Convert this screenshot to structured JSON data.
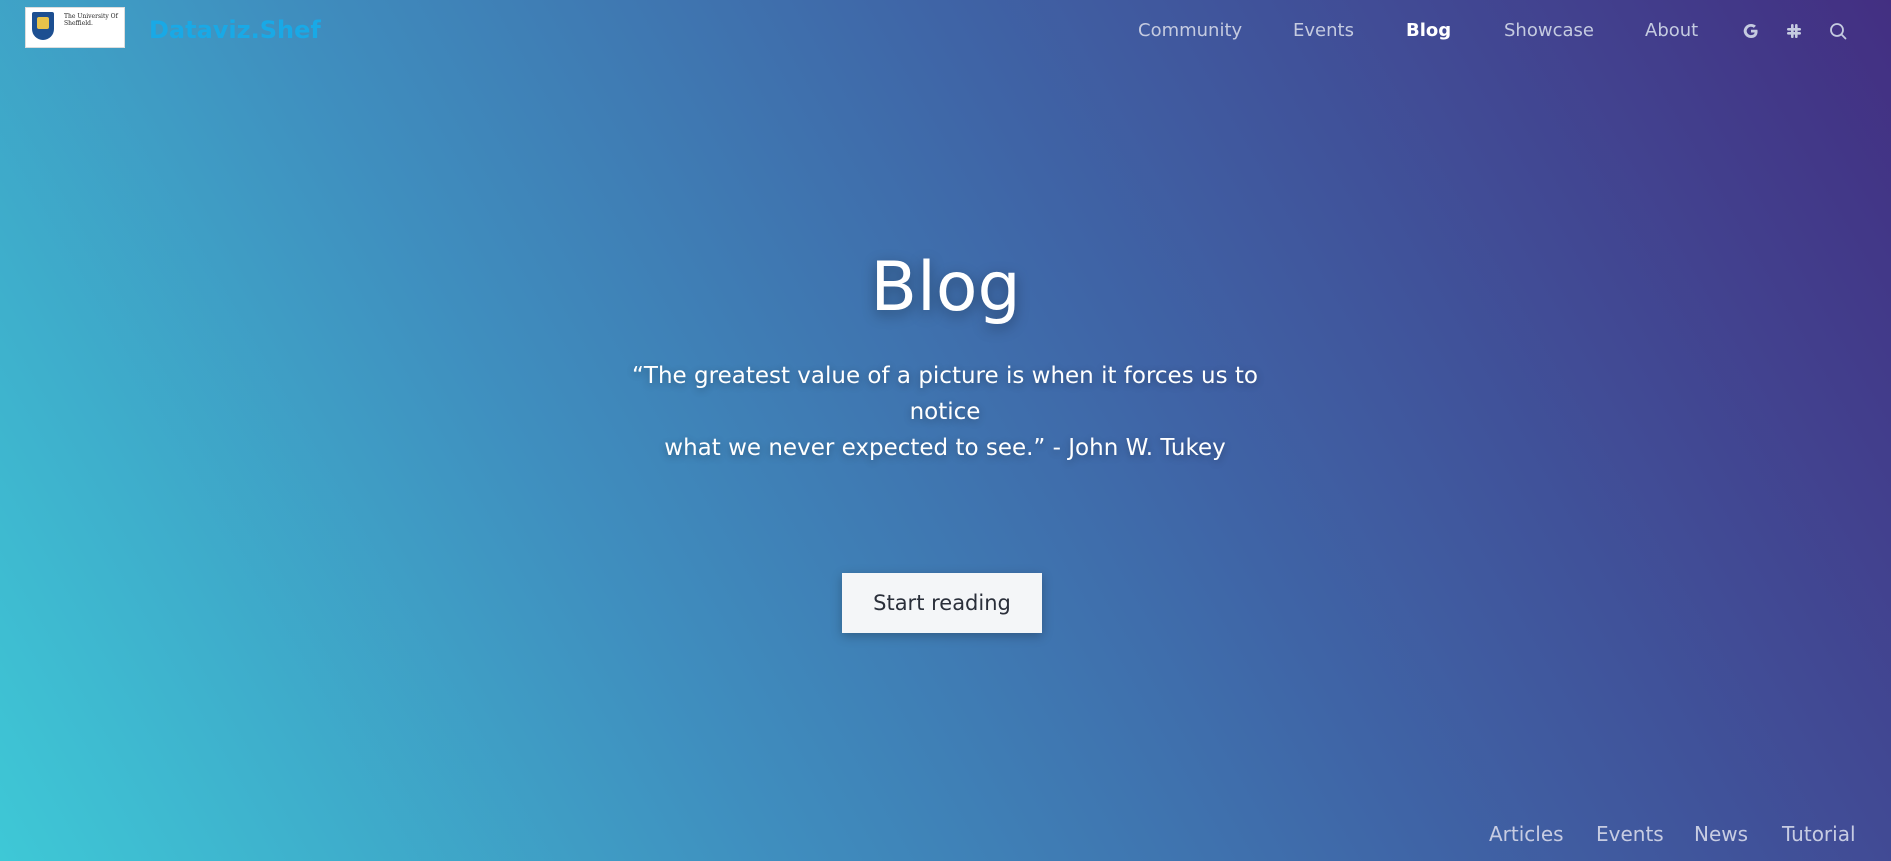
{
  "logo": {
    "text": "The University Of Sheffield."
  },
  "brand": "Dataviz.Shef",
  "nav": {
    "items": [
      "Community",
      "Events",
      "Blog",
      "Showcase",
      "About"
    ],
    "active": "Blog",
    "icons": [
      "google-icon",
      "slack-icon",
      "search-icon"
    ]
  },
  "hero": {
    "title": "Blog",
    "quote_line1": "“The greatest value of a picture is when it forces us to notice",
    "quote_line2": "what we never expected to see.” - John W. Tukey",
    "cta": "Start reading"
  },
  "subnav": [
    "Articles",
    "Events",
    "News",
    "Tutorial"
  ],
  "colors": {
    "brand": "#19a9e6",
    "gradient_start": "#3ec8d6",
    "gradient_end": "#432f82",
    "nav_text": "#c5cbe0",
    "button_bg": "#f4f6f8"
  }
}
